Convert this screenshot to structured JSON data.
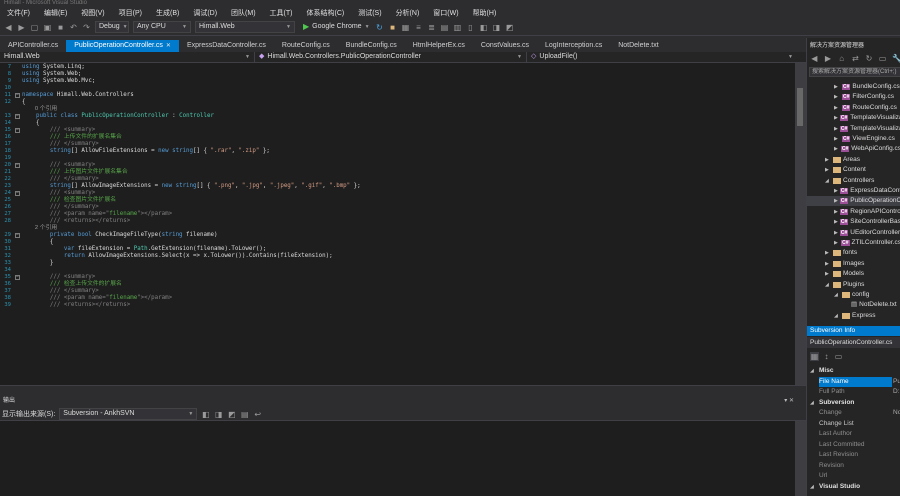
{
  "window": {
    "title": "Himall - Microsoft Visual Studio"
  },
  "menu": [
    "文件(F)",
    "编辑(E)",
    "视图(V)",
    "项目(P)",
    "生成(B)",
    "调试(D)",
    "团队(M)",
    "工具(T)",
    "体系结构(C)",
    "测试(S)",
    "分析(N)",
    "窗口(W)",
    "帮助(H)"
  ],
  "toolbar": {
    "config": "Debug",
    "platform": "Any CPU",
    "project": "Himall.Web",
    "run": "Google Chrome"
  },
  "tabs": [
    {
      "label": "APIController.cs",
      "active": false
    },
    {
      "label": "PublicOperationController.cs",
      "active": true
    },
    {
      "label": "ExpressDataController.cs",
      "active": false
    },
    {
      "label": "RouteConfig.cs",
      "active": false
    },
    {
      "label": "BundleConfig.cs",
      "active": false
    },
    {
      "label": "HtmlHelperEx.cs",
      "active": false
    },
    {
      "label": "ConstValues.cs",
      "active": false
    },
    {
      "label": "LogInterception.cs",
      "active": false
    },
    {
      "label": "NotDelete.txt",
      "active": false
    }
  ],
  "nav": {
    "project": "Himall.Web",
    "class": "Himall.Web.Controllers.PublicOperationController",
    "member": "UploadFile()"
  },
  "editor": {
    "lines": [
      {
        "n": "7",
        "t": [
          {
            "c": "kw",
            "v": "using "
          },
          {
            "c": "",
            "v": "System.Linq;"
          }
        ]
      },
      {
        "n": "8",
        "t": [
          {
            "c": "kw",
            "v": "using "
          },
          {
            "c": "",
            "v": "System.Web;"
          }
        ]
      },
      {
        "n": "9",
        "t": [
          {
            "c": "kw",
            "v": "using "
          },
          {
            "c": "",
            "v": "System.Web.Mvc;"
          }
        ]
      },
      {
        "n": "10",
        "t": []
      },
      {
        "n": "11",
        "t": [
          {
            "c": "kw",
            "v": "namespace "
          },
          {
            "c": "",
            "v": "Himall.Web.Controllers"
          }
        ]
      },
      {
        "n": "12",
        "t": [
          {
            "c": "",
            "v": "{"
          }
        ]
      },
      {
        "n": "",
        "t": [
          {
            "c": "ref",
            "v": "        0 个引用"
          }
        ]
      },
      {
        "n": "13",
        "t": [
          {
            "c": "kw",
            "v": "    public class "
          },
          {
            "c": "ty",
            "v": "PublicOperationController"
          },
          {
            "c": "",
            "v": " : "
          },
          {
            "c": "ty",
            "v": "Controller"
          }
        ]
      },
      {
        "n": "14",
        "t": [
          {
            "c": "",
            "v": "    {"
          }
        ]
      },
      {
        "n": "15",
        "t": [
          {
            "c": "cg",
            "v": "        /// <summary>"
          }
        ]
      },
      {
        "n": "16",
        "t": [
          {
            "c": "cm",
            "v": "        /// 上传文件的扩展名集合"
          }
        ]
      },
      {
        "n": "17",
        "t": [
          {
            "c": "cg",
            "v": "        /// </summary>"
          }
        ]
      },
      {
        "n": "18",
        "t": [
          {
            "c": "kw",
            "v": "        string"
          },
          {
            "c": "",
            "v": "[] AllowFileExtensions = "
          },
          {
            "c": "kw",
            "v": "new string"
          },
          {
            "c": "",
            "v": "[] { "
          },
          {
            "c": "st",
            "v": "\".rar\""
          },
          {
            "c": "",
            "v": ", "
          },
          {
            "c": "st",
            "v": "\".zip\""
          },
          {
            "c": "",
            "v": " };"
          }
        ]
      },
      {
        "n": "19",
        "t": []
      },
      {
        "n": "20",
        "t": [
          {
            "c": "cg",
            "v": "        /// <summary>"
          }
        ]
      },
      {
        "n": "21",
        "t": [
          {
            "c": "cm",
            "v": "        /// 上传图片文件扩展名集合"
          }
        ]
      },
      {
        "n": "22",
        "t": [
          {
            "c": "cg",
            "v": "        /// </summary>"
          }
        ]
      },
      {
        "n": "23",
        "t": [
          {
            "c": "kw",
            "v": "        string"
          },
          {
            "c": "",
            "v": "[] AllowImageExtensions = "
          },
          {
            "c": "kw",
            "v": "new string"
          },
          {
            "c": "",
            "v": "[] { "
          },
          {
            "c": "st",
            "v": "\".png\""
          },
          {
            "c": "",
            "v": ", "
          },
          {
            "c": "st",
            "v": "\".jpg\""
          },
          {
            "c": "",
            "v": ", "
          },
          {
            "c": "st",
            "v": "\".jpeg\""
          },
          {
            "c": "",
            "v": ", "
          },
          {
            "c": "st",
            "v": "\".gif\""
          },
          {
            "c": "",
            "v": ", "
          },
          {
            "c": "st",
            "v": "\".bmp\""
          },
          {
            "c": "",
            "v": " };"
          }
        ]
      },
      {
        "n": "24",
        "t": [
          {
            "c": "cg",
            "v": "        /// <summary>"
          }
        ]
      },
      {
        "n": "25",
        "t": [
          {
            "c": "cm",
            "v": "        /// 检查图片文件扩展名"
          }
        ]
      },
      {
        "n": "26",
        "t": [
          {
            "c": "cg",
            "v": "        /// </summary>"
          }
        ]
      },
      {
        "n": "27",
        "t": [
          {
            "c": "cg",
            "v": "        /// <param name=\""
          },
          {
            "c": "cm",
            "v": "filename"
          },
          {
            "c": "cg",
            "v": "\"></param>"
          }
        ]
      },
      {
        "n": "28",
        "t": [
          {
            "c": "cg",
            "v": "        /// <returns></returns>"
          }
        ]
      },
      {
        "n": "",
        "t": [
          {
            "c": "ref",
            "v": "        2 个引用"
          }
        ]
      },
      {
        "n": "29",
        "t": [
          {
            "c": "kw",
            "v": "        private bool "
          },
          {
            "c": "",
            "v": "CheckImageFileType("
          },
          {
            "c": "kw",
            "v": "string"
          },
          {
            "c": "",
            "v": " filename)"
          }
        ]
      },
      {
        "n": "30",
        "t": [
          {
            "c": "",
            "v": "        {"
          }
        ]
      },
      {
        "n": "31",
        "t": [
          {
            "c": "kw",
            "v": "            var"
          },
          {
            "c": "",
            "v": " fileExtension = "
          },
          {
            "c": "ty",
            "v": "Path"
          },
          {
            "c": "",
            "v": ".GetExtension(filename).ToLower();"
          }
        ]
      },
      {
        "n": "32",
        "t": [
          {
            "c": "kw",
            "v": "            return"
          },
          {
            "c": "",
            "v": " AllowImageExtensions.Select(x => x.ToLower()).Contains(fileExtension);"
          }
        ]
      },
      {
        "n": "33",
        "t": [
          {
            "c": "",
            "v": "        }"
          }
        ]
      },
      {
        "n": "34",
        "t": []
      },
      {
        "n": "35",
        "t": [
          {
            "c": "cg",
            "v": "        /// <summary>"
          }
        ]
      },
      {
        "n": "36",
        "t": [
          {
            "c": "cm",
            "v": "        /// 检查上传文件的扩展名"
          }
        ]
      },
      {
        "n": "37",
        "t": [
          {
            "c": "cg",
            "v": "        /// </summary>"
          }
        ]
      },
      {
        "n": "38",
        "t": [
          {
            "c": "cg",
            "v": "        /// <param name=\""
          },
          {
            "c": "cm",
            "v": "filename"
          },
          {
            "c": "cg",
            "v": "\"></param>"
          }
        ]
      },
      {
        "n": "39",
        "t": [
          {
            "c": "cg",
            "v": "        /// <returns></returns>"
          }
        ]
      }
    ]
  },
  "output": {
    "title": "输出",
    "source_label": "显示输出来源(S):",
    "source": "Subversion - AnkhSVN"
  },
  "solution_explorer": {
    "title": "解决方案资源管理器",
    "search_placeholder": "搜索解决方案资源管理器(Ctrl+;)",
    "items": [
      {
        "label": "BundleConfig.cs",
        "type": "cs",
        "depth": 3
      },
      {
        "label": "FilterConfig.cs",
        "type": "cs",
        "depth": 3
      },
      {
        "label": "RouteConfig.cs",
        "type": "cs",
        "depth": 3
      },
      {
        "label": "TemplateVisualizationConfig.cs",
        "type": "cs",
        "depth": 3
      },
      {
        "label": "TemplateVisualizationHelper.cs",
        "type": "cs",
        "depth": 3
      },
      {
        "label": "ViewEngine.cs",
        "type": "cs",
        "depth": 3
      },
      {
        "label": "WebApiConfig.cs",
        "type": "cs",
        "depth": 3
      },
      {
        "label": "Areas",
        "type": "folder",
        "depth": 2
      },
      {
        "label": "Content",
        "type": "folder",
        "depth": 2
      },
      {
        "label": "Controllers",
        "type": "folder-open",
        "depth": 2
      },
      {
        "label": "ExpressDataController.cs",
        "type": "cs",
        "depth": 3
      },
      {
        "label": "PublicOperationController.cs",
        "type": "cs",
        "depth": 3,
        "selected": true
      },
      {
        "label": "RegionAPIController.cs",
        "type": "cs",
        "depth": 3
      },
      {
        "label": "SiteControllerBase.cs",
        "type": "cs",
        "depth": 3
      },
      {
        "label": "UEditorController.cs",
        "type": "cs",
        "depth": 3
      },
      {
        "label": "ZTILController.cs",
        "type": "cs",
        "depth": 3
      },
      {
        "label": "fonts",
        "type": "folder",
        "depth": 2
      },
      {
        "label": "Images",
        "type": "folder",
        "depth": 2
      },
      {
        "label": "Models",
        "type": "folder",
        "depth": 2
      },
      {
        "label": "Plugins",
        "type": "folder-open",
        "depth": 2
      },
      {
        "label": "config",
        "type": "folder-open",
        "depth": 3
      },
      {
        "label": "NotDelete.txt",
        "type": "file",
        "depth": 4
      },
      {
        "label": "Express",
        "type": "folder-open",
        "depth": 3
      }
    ]
  },
  "subversion_info": {
    "title": "Subversion Info",
    "selected": "PublicOperationController.cs",
    "rows": [
      {
        "label": "Misc",
        "kind": "category"
      },
      {
        "label": "File Name",
        "value": "Pu",
        "kind": "selected"
      },
      {
        "label": "Full Path",
        "value": "D:",
        "kind": "dim"
      },
      {
        "label": "Subversion",
        "kind": "category"
      },
      {
        "label": "Change",
        "value": "No",
        "kind": "dim"
      },
      {
        "label": "Change List",
        "value": "",
        "kind": "normal"
      },
      {
        "label": "Last Author",
        "value": "",
        "kind": "dim"
      },
      {
        "label": "Last Committed",
        "value": "",
        "kind": "dim"
      },
      {
        "label": "Last Revision",
        "value": "",
        "kind": "dim"
      },
      {
        "label": "Revision",
        "value": "",
        "kind": "dim"
      },
      {
        "label": "Url",
        "value": "",
        "kind": "dim"
      },
      {
        "label": "Visual Studio",
        "kind": "category"
      }
    ]
  }
}
